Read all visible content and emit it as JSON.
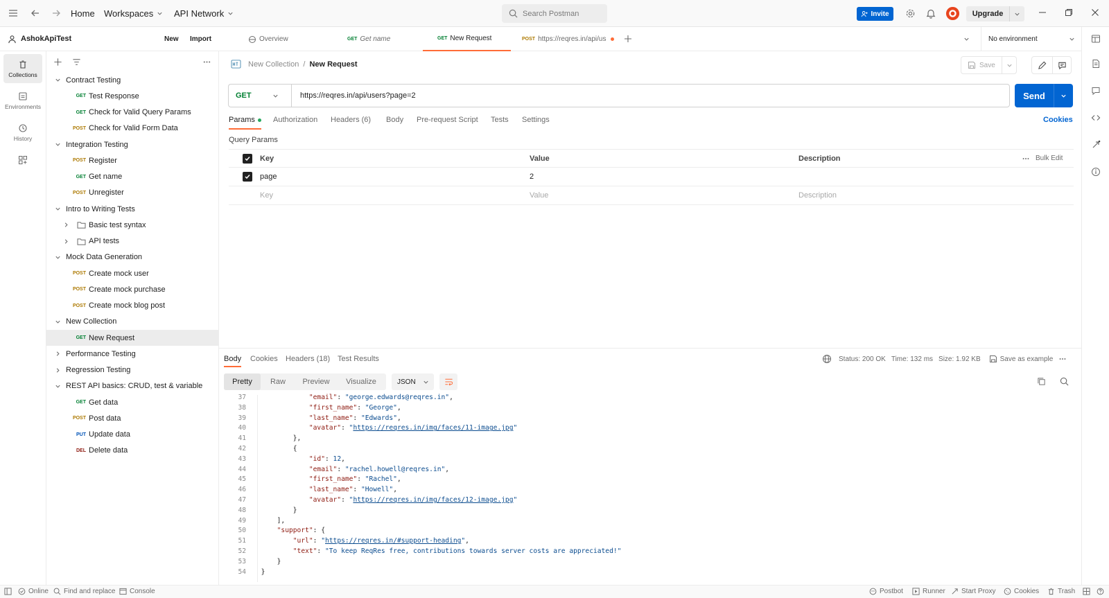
{
  "topbar": {
    "home": "Home",
    "workspaces": "Workspaces",
    "api_network": "API Network",
    "search_placeholder": "Search Postman",
    "invite": "Invite",
    "upgrade": "Upgrade"
  },
  "workspace": {
    "name": "AshokApiTest",
    "new_label": "New",
    "import_label": "Import"
  },
  "rail": {
    "collections": "Collections",
    "environments": "Environments",
    "history": "History"
  },
  "tree": [
    {
      "type": "folder",
      "label": "Contract Testing",
      "open": true
    },
    {
      "type": "req",
      "method": "GET",
      "label": "Test Response"
    },
    {
      "type": "req",
      "method": "GET",
      "label": "Check for Valid Query Params"
    },
    {
      "type": "req",
      "method": "POST",
      "label": "Check for Valid Form Data"
    },
    {
      "type": "folder",
      "label": "Integration Testing",
      "open": true
    },
    {
      "type": "req",
      "method": "POST",
      "label": "Register"
    },
    {
      "type": "req",
      "method": "GET",
      "label": "Get name"
    },
    {
      "type": "req",
      "method": "POST",
      "label": "Unregister"
    },
    {
      "type": "folder",
      "label": "Intro to Writing Tests",
      "open": true
    },
    {
      "type": "subfolder",
      "label": "Basic test syntax"
    },
    {
      "type": "subfolder",
      "label": "API tests"
    },
    {
      "type": "folder",
      "label": "Mock Data Generation",
      "open": true
    },
    {
      "type": "req",
      "method": "POST",
      "label": "Create mock user"
    },
    {
      "type": "req",
      "method": "POST",
      "label": "Create mock purchase"
    },
    {
      "type": "req",
      "method": "POST",
      "label": "Create mock blog post"
    },
    {
      "type": "folder",
      "label": "New Collection",
      "open": true
    },
    {
      "type": "req",
      "method": "GET",
      "label": "New Request",
      "active": true
    },
    {
      "type": "folder",
      "label": "Performance Testing",
      "open": false
    },
    {
      "type": "folder",
      "label": "Regression Testing",
      "open": false
    },
    {
      "type": "folder",
      "label": "REST API basics: CRUD, test & variable",
      "open": true
    },
    {
      "type": "req",
      "method": "GET",
      "label": "Get data"
    },
    {
      "type": "req",
      "method": "POST",
      "label": "Post data"
    },
    {
      "type": "req",
      "method": "PUT",
      "label": "Update data"
    },
    {
      "type": "req",
      "method": "DEL",
      "label": "Delete data"
    }
  ],
  "tabs": [
    {
      "label": "Overview",
      "method": ""
    },
    {
      "label": "Get name",
      "method": "GET"
    },
    {
      "label": "New Request",
      "method": "GET",
      "active": true
    },
    {
      "label": "https://reqres.in/api/us",
      "method": "POST"
    }
  ],
  "environment": "No environment",
  "breadcrumb": {
    "collection": "New Collection",
    "sep": "/",
    "request": "New Request"
  },
  "save_label": "Save",
  "request": {
    "method": "GET",
    "url": "https://reqres.in/api/users?page=2",
    "send": "Send"
  },
  "req_tabs": [
    "Params",
    "Authorization",
    "Headers (6)",
    "Body",
    "Pre-request Script",
    "Tests",
    "Settings"
  ],
  "cookies_link": "Cookies",
  "query_params_title": "Query Params",
  "params_table": {
    "headers": [
      "Key",
      "Value",
      "Description"
    ],
    "bulk_edit": "Bulk Edit",
    "row": {
      "key": "page",
      "value": "2"
    },
    "placeholders": {
      "key": "Key",
      "value": "Value",
      "description": "Description"
    }
  },
  "response": {
    "tabs": [
      "Body",
      "Cookies",
      "Headers (18)",
      "Test Results"
    ],
    "status": "Status: 200 OK",
    "time": "Time: 132 ms",
    "size": "Size: 1.92 KB",
    "save_example": "Save as example",
    "formats": [
      "Pretty",
      "Raw",
      "Preview",
      "Visualize"
    ],
    "lang": "JSON"
  },
  "code_lines": [
    {
      "n": "37",
      "i": 6,
      "parts": [
        [
          "k",
          "\"email\""
        ],
        [
          "p",
          ": "
        ],
        [
          "s",
          "\"george.edwards@reqres.in\""
        ],
        [
          "p",
          ","
        ]
      ]
    },
    {
      "n": "38",
      "i": 6,
      "parts": [
        [
          "k",
          "\"first_name\""
        ],
        [
          "p",
          ": "
        ],
        [
          "s",
          "\"George\""
        ],
        [
          "p",
          ","
        ]
      ]
    },
    {
      "n": "39",
      "i": 6,
      "parts": [
        [
          "k",
          "\"last_name\""
        ],
        [
          "p",
          ": "
        ],
        [
          "s",
          "\"Edwards\""
        ],
        [
          "p",
          ","
        ]
      ]
    },
    {
      "n": "40",
      "i": 6,
      "parts": [
        [
          "k",
          "\"avatar\""
        ],
        [
          "p",
          ": "
        ],
        [
          "s",
          "\""
        ],
        [
          "u",
          "https://reqres.in/img/faces/11-image.jpg"
        ],
        [
          "s",
          "\""
        ]
      ]
    },
    {
      "n": "41",
      "i": 4,
      "parts": [
        [
          "p",
          "},"
        ]
      ]
    },
    {
      "n": "42",
      "i": 4,
      "parts": [
        [
          "p",
          "{"
        ]
      ]
    },
    {
      "n": "43",
      "i": 6,
      "parts": [
        [
          "k",
          "\"id\""
        ],
        [
          "p",
          ": "
        ],
        [
          "n",
          "12"
        ],
        [
          "p",
          ","
        ]
      ]
    },
    {
      "n": "44",
      "i": 6,
      "parts": [
        [
          "k",
          "\"email\""
        ],
        [
          "p",
          ": "
        ],
        [
          "s",
          "\"rachel.howell@reqres.in\""
        ],
        [
          "p",
          ","
        ]
      ]
    },
    {
      "n": "45",
      "i": 6,
      "parts": [
        [
          "k",
          "\"first_name\""
        ],
        [
          "p",
          ": "
        ],
        [
          "s",
          "\"Rachel\""
        ],
        [
          "p",
          ","
        ]
      ]
    },
    {
      "n": "46",
      "i": 6,
      "parts": [
        [
          "k",
          "\"last_name\""
        ],
        [
          "p",
          ": "
        ],
        [
          "s",
          "\"Howell\""
        ],
        [
          "p",
          ","
        ]
      ]
    },
    {
      "n": "47",
      "i": 6,
      "parts": [
        [
          "k",
          "\"avatar\""
        ],
        [
          "p",
          ": "
        ],
        [
          "s",
          "\""
        ],
        [
          "u",
          "https://reqres.in/img/faces/12-image.jpg"
        ],
        [
          "s",
          "\""
        ]
      ]
    },
    {
      "n": "48",
      "i": 4,
      "parts": [
        [
          "p",
          "}"
        ]
      ]
    },
    {
      "n": "49",
      "i": 2,
      "parts": [
        [
          "p",
          "],"
        ]
      ]
    },
    {
      "n": "50",
      "i": 2,
      "parts": [
        [
          "k",
          "\"support\""
        ],
        [
          "p",
          ": {"
        ]
      ]
    },
    {
      "n": "51",
      "i": 4,
      "parts": [
        [
          "k",
          "\"url\""
        ],
        [
          "p",
          ": "
        ],
        [
          "s",
          "\""
        ],
        [
          "u",
          "https://reqres.in/#support-heading"
        ],
        [
          "s",
          "\""
        ],
        [
          "p",
          ","
        ]
      ]
    },
    {
      "n": "52",
      "i": 4,
      "parts": [
        [
          "k",
          "\"text\""
        ],
        [
          "p",
          ": "
        ],
        [
          "s",
          "\"To keep ReqRes free, contributions towards server costs are appreciated!\""
        ]
      ]
    },
    {
      "n": "53",
      "i": 2,
      "parts": [
        [
          "p",
          "}"
        ]
      ]
    },
    {
      "n": "54",
      "i": 0,
      "parts": [
        [
          "p",
          "}"
        ]
      ]
    }
  ],
  "statusbar": {
    "online": "Online",
    "find_replace": "Find and replace",
    "console": "Console",
    "postbot": "Postbot",
    "runner": "Runner",
    "start_proxy": "Start Proxy",
    "cookies": "Cookies",
    "trash": "Trash"
  },
  "colors": {
    "accent": "#ff6c37",
    "primary": "#0265d2",
    "get": "#007f31",
    "post": "#ad7a03",
    "put": "#0053b8",
    "del": "#8e1a10"
  }
}
